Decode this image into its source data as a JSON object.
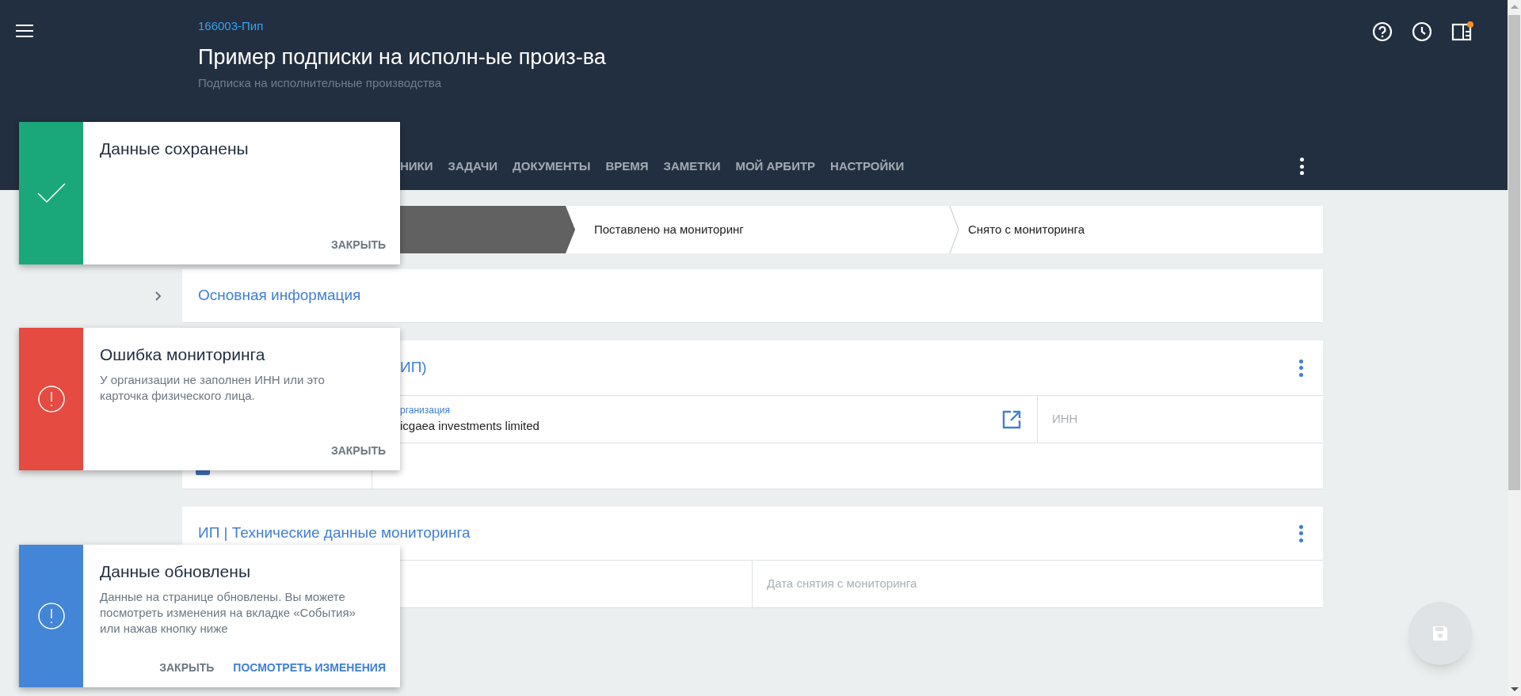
{
  "header": {
    "case_number": "166003-Пип",
    "title": "Пример подписки на исполн-ые произ-ва",
    "subtitle": "Подписка на исполнительные производства"
  },
  "tabs": [
    {
      "label": "НИКИ"
    },
    {
      "label": "ЗАДАЧИ"
    },
    {
      "label": "ДОКУМЕНТЫ"
    },
    {
      "label": "ВРЕМЯ"
    },
    {
      "label": "ЗАМЕТКИ"
    },
    {
      "label": "МОЙ АРБИТР"
    },
    {
      "label": "НАСТРОЙКИ"
    }
  ],
  "stepper": [
    {
      "selected": true
    },
    {
      "label": "Поставлено на мониторинг",
      "selected": false
    },
    {
      "label": "Снято с мониторинга",
      "selected": false
    }
  ],
  "sections": [
    {
      "kind": "collapsed",
      "title": "Основная информация",
      "expanded": false
    },
    {
      "kind": "org",
      "title": "ИП)",
      "org_label": "рганизация",
      "org_value": "icgaea investments limited",
      "inn_placeholder": "ИНН",
      "checked": true
    },
    {
      "kind": "tech",
      "title": "ИП | Технические данные мониторинга",
      "date_placeholder": "Дата снятия с мониторинга"
    }
  ],
  "toasts": [
    {
      "kind": "success",
      "title": "Данные сохранены",
      "buttons": [
        {
          "label": "ЗАКРЫТЬ",
          "primary": false
        }
      ]
    },
    {
      "kind": "error",
      "title": "Ошибка мониторинга",
      "text": "У организации не заполнен ИНН или это карточка физического лица.",
      "buttons": [
        {
          "label": "ЗАКРЫТЬ",
          "primary": false
        }
      ]
    },
    {
      "kind": "info",
      "title": "Данные обновлены",
      "text": "Данные на странице обновлены. Вы можете посмотреть изменения на вкладке «События» или нажав кнопку ниже",
      "buttons": [
        {
          "label": "ЗАКРЫТЬ",
          "primary": false
        },
        {
          "label": "ПОСМОТРЕТЬ ИЗМЕНЕНИЯ",
          "primary": true
        }
      ]
    }
  ]
}
